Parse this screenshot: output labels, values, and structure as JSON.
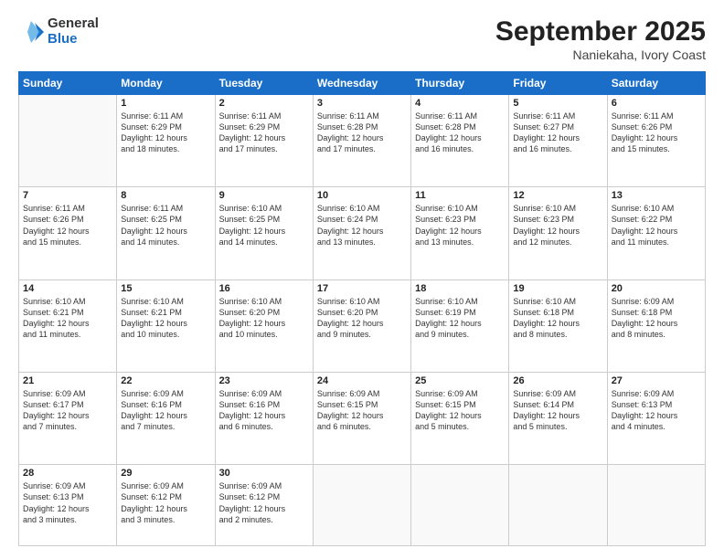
{
  "logo": {
    "line1": "General",
    "line2": "Blue"
  },
  "title": {
    "month_year": "September 2025",
    "location": "Naniekaha, Ivory Coast"
  },
  "headers": [
    "Sunday",
    "Monday",
    "Tuesday",
    "Wednesday",
    "Thursday",
    "Friday",
    "Saturday"
  ],
  "weeks": [
    [
      {
        "day": "",
        "content": ""
      },
      {
        "day": "1",
        "content": "Sunrise: 6:11 AM\nSunset: 6:29 PM\nDaylight: 12 hours\nand 18 minutes."
      },
      {
        "day": "2",
        "content": "Sunrise: 6:11 AM\nSunset: 6:29 PM\nDaylight: 12 hours\nand 17 minutes."
      },
      {
        "day": "3",
        "content": "Sunrise: 6:11 AM\nSunset: 6:28 PM\nDaylight: 12 hours\nand 17 minutes."
      },
      {
        "day": "4",
        "content": "Sunrise: 6:11 AM\nSunset: 6:28 PM\nDaylight: 12 hours\nand 16 minutes."
      },
      {
        "day": "5",
        "content": "Sunrise: 6:11 AM\nSunset: 6:27 PM\nDaylight: 12 hours\nand 16 minutes."
      },
      {
        "day": "6",
        "content": "Sunrise: 6:11 AM\nSunset: 6:26 PM\nDaylight: 12 hours\nand 15 minutes."
      }
    ],
    [
      {
        "day": "7",
        "content": "Sunrise: 6:11 AM\nSunset: 6:26 PM\nDaylight: 12 hours\nand 15 minutes."
      },
      {
        "day": "8",
        "content": "Sunrise: 6:11 AM\nSunset: 6:25 PM\nDaylight: 12 hours\nand 14 minutes."
      },
      {
        "day": "9",
        "content": "Sunrise: 6:10 AM\nSunset: 6:25 PM\nDaylight: 12 hours\nand 14 minutes."
      },
      {
        "day": "10",
        "content": "Sunrise: 6:10 AM\nSunset: 6:24 PM\nDaylight: 12 hours\nand 13 minutes."
      },
      {
        "day": "11",
        "content": "Sunrise: 6:10 AM\nSunset: 6:23 PM\nDaylight: 12 hours\nand 13 minutes."
      },
      {
        "day": "12",
        "content": "Sunrise: 6:10 AM\nSunset: 6:23 PM\nDaylight: 12 hours\nand 12 minutes."
      },
      {
        "day": "13",
        "content": "Sunrise: 6:10 AM\nSunset: 6:22 PM\nDaylight: 12 hours\nand 11 minutes."
      }
    ],
    [
      {
        "day": "14",
        "content": "Sunrise: 6:10 AM\nSunset: 6:21 PM\nDaylight: 12 hours\nand 11 minutes."
      },
      {
        "day": "15",
        "content": "Sunrise: 6:10 AM\nSunset: 6:21 PM\nDaylight: 12 hours\nand 10 minutes."
      },
      {
        "day": "16",
        "content": "Sunrise: 6:10 AM\nSunset: 6:20 PM\nDaylight: 12 hours\nand 10 minutes."
      },
      {
        "day": "17",
        "content": "Sunrise: 6:10 AM\nSunset: 6:20 PM\nDaylight: 12 hours\nand 9 minutes."
      },
      {
        "day": "18",
        "content": "Sunrise: 6:10 AM\nSunset: 6:19 PM\nDaylight: 12 hours\nand 9 minutes."
      },
      {
        "day": "19",
        "content": "Sunrise: 6:10 AM\nSunset: 6:18 PM\nDaylight: 12 hours\nand 8 minutes."
      },
      {
        "day": "20",
        "content": "Sunrise: 6:09 AM\nSunset: 6:18 PM\nDaylight: 12 hours\nand 8 minutes."
      }
    ],
    [
      {
        "day": "21",
        "content": "Sunrise: 6:09 AM\nSunset: 6:17 PM\nDaylight: 12 hours\nand 7 minutes."
      },
      {
        "day": "22",
        "content": "Sunrise: 6:09 AM\nSunset: 6:16 PM\nDaylight: 12 hours\nand 7 minutes."
      },
      {
        "day": "23",
        "content": "Sunrise: 6:09 AM\nSunset: 6:16 PM\nDaylight: 12 hours\nand 6 minutes."
      },
      {
        "day": "24",
        "content": "Sunrise: 6:09 AM\nSunset: 6:15 PM\nDaylight: 12 hours\nand 6 minutes."
      },
      {
        "day": "25",
        "content": "Sunrise: 6:09 AM\nSunset: 6:15 PM\nDaylight: 12 hours\nand 5 minutes."
      },
      {
        "day": "26",
        "content": "Sunrise: 6:09 AM\nSunset: 6:14 PM\nDaylight: 12 hours\nand 5 minutes."
      },
      {
        "day": "27",
        "content": "Sunrise: 6:09 AM\nSunset: 6:13 PM\nDaylight: 12 hours\nand 4 minutes."
      }
    ],
    [
      {
        "day": "28",
        "content": "Sunrise: 6:09 AM\nSunset: 6:13 PM\nDaylight: 12 hours\nand 3 minutes."
      },
      {
        "day": "29",
        "content": "Sunrise: 6:09 AM\nSunset: 6:12 PM\nDaylight: 12 hours\nand 3 minutes."
      },
      {
        "day": "30",
        "content": "Sunrise: 6:09 AM\nSunset: 6:12 PM\nDaylight: 12 hours\nand 2 minutes."
      },
      {
        "day": "",
        "content": ""
      },
      {
        "day": "",
        "content": ""
      },
      {
        "day": "",
        "content": ""
      },
      {
        "day": "",
        "content": ""
      }
    ]
  ]
}
